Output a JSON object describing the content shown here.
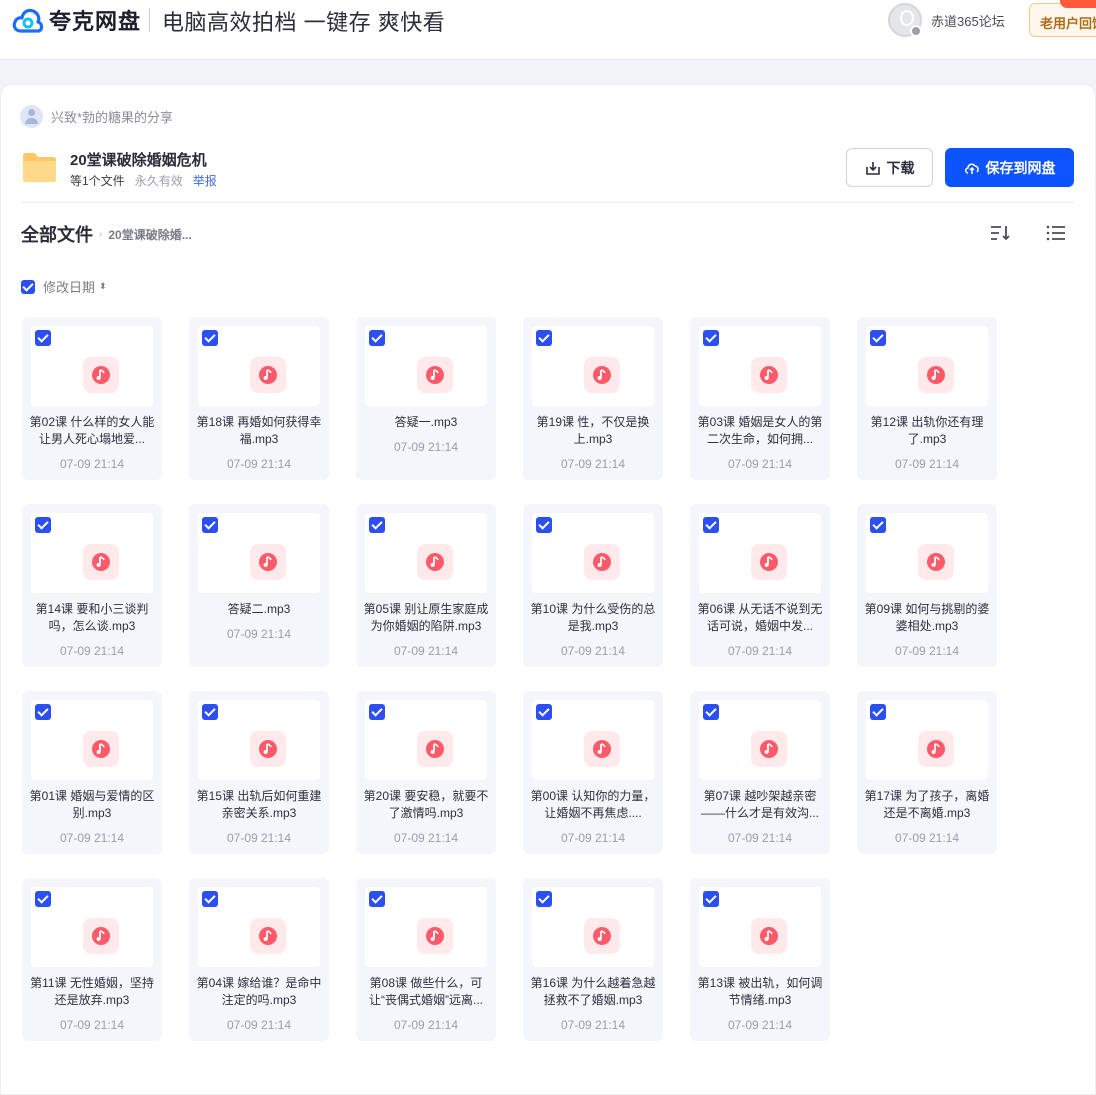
{
  "header": {
    "logo_text": "夸克网盘",
    "slogan": "电脑高效拍档 一键存 爽快看",
    "user_name": "赤道365论坛",
    "old_user_button": "老用户回馈"
  },
  "share": {
    "sharer": "兴致*勃的糖果的分享",
    "title": "20堂课破除婚姻危机",
    "file_count": "等1个文件",
    "validity": "永久有效",
    "report": "举报",
    "download_label": "下载",
    "save_label": "保存到网盘"
  },
  "breadcrumb": {
    "root": "全部文件",
    "current": "20堂课破除婚..."
  },
  "sort": {
    "label": "修改日期"
  },
  "files": [
    {
      "name": "第02课 什么样的女人能让男人死心塌地爱...",
      "date": "07-09 21:14"
    },
    {
      "name": "第18课 再婚如何获得幸福.mp3",
      "date": "07-09 21:14"
    },
    {
      "name": "答疑一.mp3",
      "date": "07-09 21:14"
    },
    {
      "name": "第19课 性，不仅是换上.mp3",
      "date": "07-09 21:14"
    },
    {
      "name": "第03课 婚姻是女人的第二次生命，如何拥...",
      "date": "07-09 21:14"
    },
    {
      "name": "第12课 出轨你还有理了.mp3",
      "date": "07-09 21:14"
    },
    {
      "name": "第14课 要和小三谈判吗，怎么谈.mp3",
      "date": "07-09 21:14"
    },
    {
      "name": "答疑二.mp3",
      "date": "07-09 21:14"
    },
    {
      "name": "第05课 别让原生家庭成为你婚姻的陷阱.mp3",
      "date": "07-09 21:14"
    },
    {
      "name": "第10课 为什么受伤的总是我.mp3",
      "date": "07-09 21:14"
    },
    {
      "name": "第06课 从无话不说到无话可说，婚姻中发...",
      "date": "07-09 21:14"
    },
    {
      "name": "第09课 如何与挑剔的婆婆相处.mp3",
      "date": "07-09 21:14"
    },
    {
      "name": "第01课 婚姻与爱情的区别.mp3",
      "date": "07-09 21:14"
    },
    {
      "name": "第15课 出轨后如何重建亲密关系.mp3",
      "date": "07-09 21:14"
    },
    {
      "name": "第20课 要安稳，就要不了激情吗.mp3",
      "date": "07-09 21:14"
    },
    {
      "name": "第00课 认知你的力量，让婚姻不再焦虑....",
      "date": "07-09 21:14"
    },
    {
      "name": "第07课 越吵架越亲密——什么才是有效沟...",
      "date": "07-09 21:14"
    },
    {
      "name": "第17课 为了孩子，离婚还是不离婚.mp3",
      "date": "07-09 21:14"
    },
    {
      "name": "第11课 无性婚姻，坚持还是放弃.mp3",
      "date": "07-09 21:14"
    },
    {
      "name": "第04课 嫁给谁？是命中注定的吗.mp3",
      "date": "07-09 21:14"
    },
    {
      "name": "第08课 做些什么，可让“丧偶式婚姻”远离...",
      "date": "07-09 21:14"
    },
    {
      "name": "第16课 为什么越着急越拯救不了婚姻.mp3",
      "date": "07-09 21:14"
    },
    {
      "name": "第13课 被出轨，如何调节情绪.mp3",
      "date": "07-09 21:14"
    }
  ],
  "colors": {
    "brand_blue": "#0d53ff",
    "checkbox_blue": "#2b4ff0",
    "music_icon": "#ff5a6a"
  },
  "icons": {
    "logo": "cloud-logo-icon",
    "download": "download-icon",
    "save": "cloud-upload-icon",
    "sort": "sort-icon",
    "view": "list-view-icon",
    "file": "music-note-icon"
  }
}
